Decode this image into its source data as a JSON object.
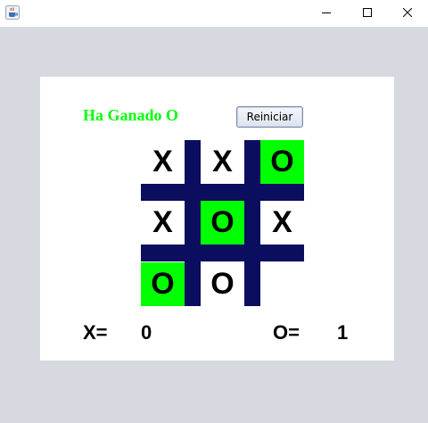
{
  "window": {
    "app_icon": "java-coffee-cup-icon",
    "controls": [
      "minimize-icon",
      "maximize-icon",
      "close-icon"
    ]
  },
  "status": {
    "text": "Ha Ganado O",
    "color": "#00ff00"
  },
  "restart_button": {
    "label": "Reiniciar"
  },
  "board": {
    "grid_color": "#0b0d5e",
    "highlight_color": "#00ff00",
    "cells": [
      {
        "mark": "X",
        "highlighted": false
      },
      {
        "mark": "X",
        "highlighted": false
      },
      {
        "mark": "O",
        "highlighted": true
      },
      {
        "mark": "X",
        "highlighted": false
      },
      {
        "mark": "O",
        "highlighted": true
      },
      {
        "mark": "X",
        "highlighted": false
      },
      {
        "mark": "O",
        "highlighted": true
      },
      {
        "mark": "O",
        "highlighted": false
      },
      {
        "mark": "",
        "highlighted": false
      }
    ]
  },
  "score": {
    "x_label": "X=",
    "x_value": "0",
    "o_label": "O=",
    "o_value": "1"
  }
}
